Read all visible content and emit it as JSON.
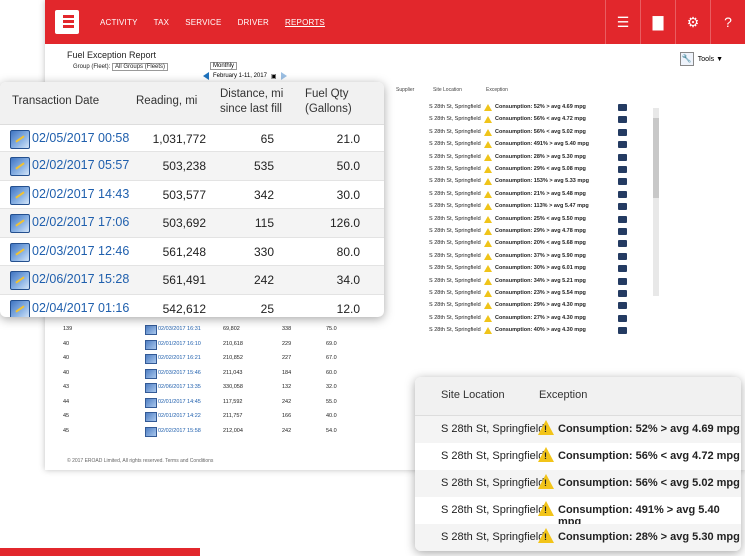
{
  "nav": {
    "items": [
      "ACTIVITY",
      "TAX",
      "SERVICE",
      "DRIVER",
      "REPORTS"
    ],
    "active": "REPORTS"
  },
  "report": {
    "title": "Fuel Exception Report",
    "group_label": "Group (Fleet):",
    "group_value": "All Groups (Fleets)",
    "period_value": "Monthly",
    "date_range": "February 1-11, 2017",
    "tools_label": "Tools ▼"
  },
  "table_headers_small": {
    "supplier": "Supplier",
    "site_location": "Site Location",
    "exception": "Exception"
  },
  "background_rows": [
    {
      "id": "139",
      "date": "02/03/2017 16:31",
      "reading": "69,802",
      "distance": "338",
      "fuel": "75.0"
    },
    {
      "id": "40",
      "date": "02/01/2017 16:10",
      "reading": "210,618",
      "distance": "229",
      "fuel": "69.0"
    },
    {
      "id": "40",
      "date": "02/02/2017 16:21",
      "reading": "210,852",
      "distance": "227",
      "fuel": "67.0"
    },
    {
      "id": "40",
      "date": "02/03/2017 15:46",
      "reading": "211,043",
      "distance": "184",
      "fuel": "60.0"
    },
    {
      "id": "43",
      "date": "02/06/2017 13:35",
      "reading": "330,058",
      "distance": "132",
      "fuel": "32.0"
    },
    {
      "id": "44",
      "date": "02/01/2017 14:45",
      "reading": "117,592",
      "distance": "242",
      "fuel": "55.0"
    },
    {
      "id": "45",
      "date": "02/01/2017 14:22",
      "reading": "211,757",
      "distance": "166",
      "fuel": "40.0"
    },
    {
      "id": "45",
      "date": "02/02/2017 15:58",
      "reading": "212,004",
      "distance": "242",
      "fuel": "54.0"
    }
  ],
  "background_exceptions": [
    {
      "site": "S 28th St, Springfield",
      "exception": "Consumption: 52% > avg 4.69 mpg"
    },
    {
      "site": "S 28th St, Springfield",
      "exception": "Consumption: 56% < avg 4.72 mpg"
    },
    {
      "site": "S 28th St, Springfield",
      "exception": "Consumption: 56% < avg 5.02 mpg"
    },
    {
      "site": "S 28th St, Springfield",
      "exception": "Consumption: 491% > avg 5.40 mpg"
    },
    {
      "site": "S 28th St, Springfield",
      "exception": "Consumption: 28% > avg 5.30 mpg"
    },
    {
      "site": "S 28th St, Springfield",
      "exception": "Consumption: 29% < avg 5.08 mpg"
    },
    {
      "site": "S 28th St, Springfield",
      "exception": "Consumption: 153% > avg 5.33 mpg"
    },
    {
      "site": "S 28th St, Springfield",
      "exception": "Consumption: 21% > avg 5.48 mpg"
    },
    {
      "site": "S 28th St, Springfield",
      "exception": "Consumption: 113% > avg 5.47 mpg"
    },
    {
      "site": "S 28th St, Springfield",
      "exception": "Consumption: 25% < avg 5.50 mpg"
    },
    {
      "site": "S 28th St, Springfield",
      "exception": "Consumption: 29% > avg 4.78 mpg"
    },
    {
      "site": "S 28th St, Springfield",
      "exception": "Consumption: 20% < avg 5.68 mpg"
    },
    {
      "site": "S 28th St, Springfield",
      "exception": "Consumption: 37% > avg 5.90 mpg"
    },
    {
      "site": "S 28th St, Springfield",
      "exception": "Consumption: 30% > avg 6.01 mpg"
    },
    {
      "site": "S 28th St, Springfield",
      "exception": "Consumption: 34% > avg 5.21 mpg"
    },
    {
      "site": "S 28th St, Springfield",
      "exception": "Consumption: 23% > avg 5.54 mpg"
    },
    {
      "site": "S 28th St, Springfield",
      "exception": "Consumption: 29% > avg 4.30 mpg"
    },
    {
      "site": "S 28th St, Springfield",
      "exception": "Consumption: 27% > avg 4.30 mpg"
    },
    {
      "site": "S 28th St, Springfield",
      "exception": "Consumption: 40% > avg 4.30 mpg"
    }
  ],
  "footer": "© 2017 EROAD Limited, All rights reserved.   Terms and Conditions",
  "zoom_transactions": {
    "headers": {
      "date": "Transaction Date",
      "reading": "Reading, mi",
      "distance_1": "Distance, mi",
      "distance_2": "since last fill",
      "fuel_1": "Fuel Qty",
      "fuel_2": "(Gallons)"
    },
    "rows": [
      {
        "date": "02/05/2017 00:58",
        "reading": "1,031,772",
        "distance": "65",
        "fuel": "21.0"
      },
      {
        "date": "02/02/2017 05:57",
        "reading": "503,238",
        "distance": "535",
        "fuel": "50.0"
      },
      {
        "date": "02/02/2017 14:43",
        "reading": "503,577",
        "distance": "342",
        "fuel": "30.0"
      },
      {
        "date": "02/02/2017 17:06",
        "reading": "503,692",
        "distance": "115",
        "fuel": "126.0"
      },
      {
        "date": "02/03/2017 12:46",
        "reading": "561,248",
        "distance": "330",
        "fuel": "80.0"
      },
      {
        "date": "02/06/2017 15:28",
        "reading": "561,491",
        "distance": "242",
        "fuel": "34.0"
      },
      {
        "date": "02/04/2017 01:16",
        "reading": "542,612",
        "distance": "25",
        "fuel": "12.0"
      }
    ]
  },
  "zoom_exceptions": {
    "headers": {
      "site": "Site Location",
      "exception": "Exception"
    },
    "rows": [
      {
        "site": "S 28th St, Springfield",
        "exception": "Consumption: 52% > avg 4.69 mpg"
      },
      {
        "site": "S 28th St, Springfield",
        "exception": "Consumption: 56% < avg 4.72 mpg"
      },
      {
        "site": "S 28th St, Springfield",
        "exception": "Consumption: 56% < avg 5.02 mpg"
      },
      {
        "site": "S 28th St, Springfield",
        "exception": "Consumption: 491% > avg 5.40 mpg"
      },
      {
        "site": "S 28th St, Springfield",
        "exception": "Consumption: 28% > avg 5.30 mpg"
      }
    ]
  },
  "colors": {
    "brand": "#e2272c",
    "link": "#1f5fad",
    "warning": "#f2c419"
  }
}
